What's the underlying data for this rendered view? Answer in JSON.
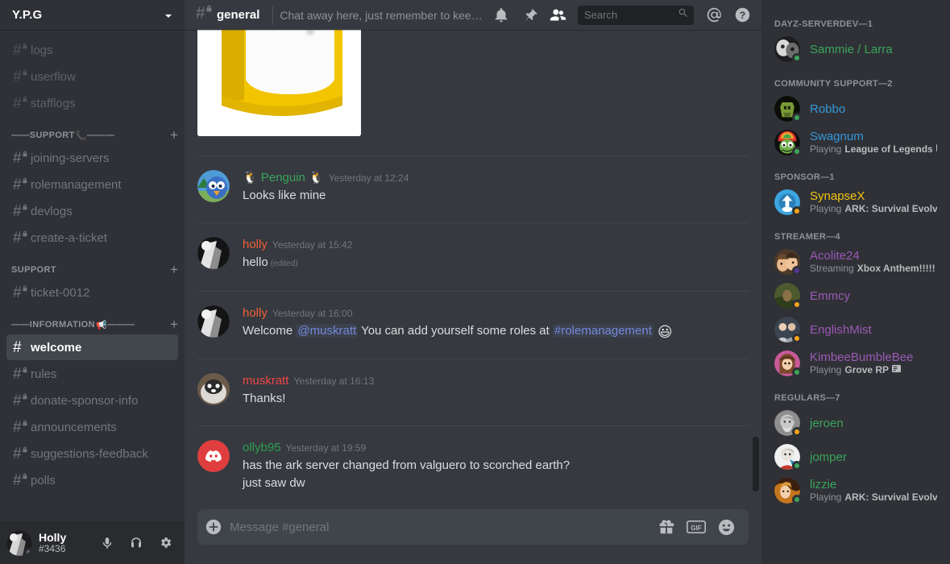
{
  "server": {
    "name": "Y.P.G",
    "chevron_icon": "chevron-down-icon"
  },
  "sidebar": {
    "top_channels": [
      {
        "name": "logs",
        "locked": true,
        "muted": true
      },
      {
        "name": "userflow",
        "locked": true,
        "muted": true
      },
      {
        "name": "stafflogs",
        "locked": true,
        "muted": true
      }
    ],
    "categories": [
      {
        "label": "——SUPPORT",
        "emoji": "📞",
        "trailing": "———",
        "decorated": true,
        "channels": [
          {
            "name": "joining-servers",
            "locked": true
          },
          {
            "name": "rolemanagement",
            "locked": true
          },
          {
            "name": "devlogs",
            "locked": true
          },
          {
            "name": "create-a-ticket",
            "locked": true
          }
        ]
      },
      {
        "label": "SUPPORT",
        "emoji": "",
        "trailing": "",
        "decorated": false,
        "channels": [
          {
            "name": "ticket-0012",
            "locked": true
          }
        ]
      },
      {
        "label": "——INFORMATION",
        "emoji": "📢",
        "trailing": "———",
        "decorated": true,
        "channels": [
          {
            "name": "welcome",
            "locked": false,
            "active": true
          },
          {
            "name": "rules",
            "locked": true
          },
          {
            "name": "donate-sponsor-info",
            "locked": true
          },
          {
            "name": "announcements",
            "locked": true
          },
          {
            "name": "suggestions-feedback",
            "locked": true
          },
          {
            "name": "polls",
            "locked": true
          }
        ]
      }
    ],
    "add_channel_icon": "plus-icon"
  },
  "user_panel": {
    "name": "Holly",
    "tag": "#3436",
    "status_color": "#747f8d",
    "mute_icon": "microphone-icon",
    "deafen_icon": "headphones-icon",
    "settings_icon": "gear-icon"
  },
  "topbar": {
    "channel_name": "general",
    "channel_locked": true,
    "topic": "Chat away here, just remember to keep things clean!",
    "icons": [
      {
        "name": "notifications-bell-icon"
      },
      {
        "name": "pinned-messages-icon"
      },
      {
        "name": "member-list-icon"
      },
      {
        "name": "mentions-icon"
      },
      {
        "name": "help-icon"
      }
    ]
  },
  "search": {
    "placeholder": "Search",
    "value": "",
    "icon": "search-icon"
  },
  "messages": [
    {
      "id": "attachment-only",
      "type": "attachment",
      "alt": "yellow and white plastic container photo"
    },
    {
      "id": "m1",
      "author": "🐧 Penguin 🐧",
      "author_color": "#3ba55c",
      "timestamp": "Yesterday at 12:24",
      "avatar_kind": "penguin",
      "lines": [
        {
          "text": "Looks like mine"
        }
      ]
    },
    {
      "id": "m2",
      "author": "holly",
      "author_color": "#f0603a",
      "timestamp": "Yesterday at 15:42",
      "avatar_kind": "holly",
      "lines": [
        {
          "text": "hello",
          "edited": "(edited)"
        }
      ]
    },
    {
      "id": "m3",
      "author": "holly",
      "author_color": "#f0603a",
      "timestamp": "Yesterday at 16:00",
      "avatar_kind": "holly",
      "lines": [
        {
          "segments": [
            {
              "kind": "text",
              "text": "Welcome "
            },
            {
              "kind": "mention",
              "text": "@muskratt"
            },
            {
              "kind": "text",
              "text": " You can add yourself some roles at "
            },
            {
              "kind": "mention",
              "text": "#rolemanagement"
            },
            {
              "kind": "emoji",
              "text": "😃"
            }
          ]
        }
      ]
    },
    {
      "id": "m4",
      "author": "muskratt",
      "author_color": "#f04747",
      "timestamp": "Yesterday at 16:13",
      "avatar_kind": "muskratt",
      "lines": [
        {
          "text": "Thanks!"
        }
      ]
    },
    {
      "id": "m5",
      "author": "ollyb95",
      "author_color": "#2e9e4f",
      "timestamp": "Yesterday at 19:59",
      "avatar_kind": "discord",
      "lines": [
        {
          "text": "has the ark server changed from valguero to scorched earth?"
        },
        {
          "text": "just saw dw"
        }
      ]
    }
  ],
  "composer": {
    "placeholder": "Message #general",
    "value": "",
    "plus_icon": "add-attachment-icon",
    "gift_icon": "gift-icon",
    "gif_icon": "gif-icon",
    "emoji_icon": "emoji-picker-icon"
  },
  "member_list": {
    "groups": [
      {
        "title": "DAYZ-SERVERDEV—1",
        "color": "#3ba55c",
        "members": [
          {
            "name": "Sammie / Larra",
            "status": "#3ba55c",
            "activity": "",
            "avatar": "sammie"
          }
        ]
      },
      {
        "title": "COMMUNITY SUPPORT—2",
        "color": "#3498db",
        "members": [
          {
            "name": "Robbo",
            "status": "#3ba55c",
            "activity": "",
            "avatar": "robbo"
          },
          {
            "name": "Swagnum",
            "status": "#3ba55c",
            "activity_prefix": "Playing",
            "activity": "League of Legends",
            "game_icon": true,
            "avatar": "swagnum"
          }
        ]
      },
      {
        "title": "SPONSOR—1",
        "color": "#f1c40f",
        "members": [
          {
            "name": "SynapseX",
            "status": "#faa61a",
            "activity_prefix": "Playing",
            "activity": "ARK: Survival Evolved",
            "avatar": "synapse"
          }
        ]
      },
      {
        "title": "STREAMER—4",
        "color": "#9b59b6",
        "members": [
          {
            "name": "Acolite24",
            "status": "#593695",
            "activity_prefix": "Streaming",
            "activity": "Xbox Anthem!!!!!",
            "game_icon": true,
            "avatar": "acolite"
          },
          {
            "name": "Emmcy",
            "status": "#faa61a",
            "activity": "",
            "avatar": "emmcy"
          },
          {
            "name": "EnglishMist",
            "status": "#faa61a",
            "activity": "",
            "avatar": "english"
          },
          {
            "name": "KimbeeBumbleBee",
            "status": "#3ba55c",
            "activity_prefix": "Playing",
            "activity": "Grove RP",
            "game_icon": true,
            "avatar": "kimbee"
          }
        ]
      },
      {
        "title": "REGULARS—7",
        "color": "#3ba55c",
        "members": [
          {
            "name": "jeroen",
            "status": "#faa61a",
            "activity": "",
            "avatar": "jeroen"
          },
          {
            "name": "jomper",
            "status": "#3ba55c",
            "activity": "",
            "avatar": "jomper"
          },
          {
            "name": "lizzie",
            "status": "#3ba55c",
            "activity_prefix": "Playing",
            "activity": "ARK: Survival Evolved",
            "avatar": "lizzie"
          }
        ]
      }
    ]
  }
}
